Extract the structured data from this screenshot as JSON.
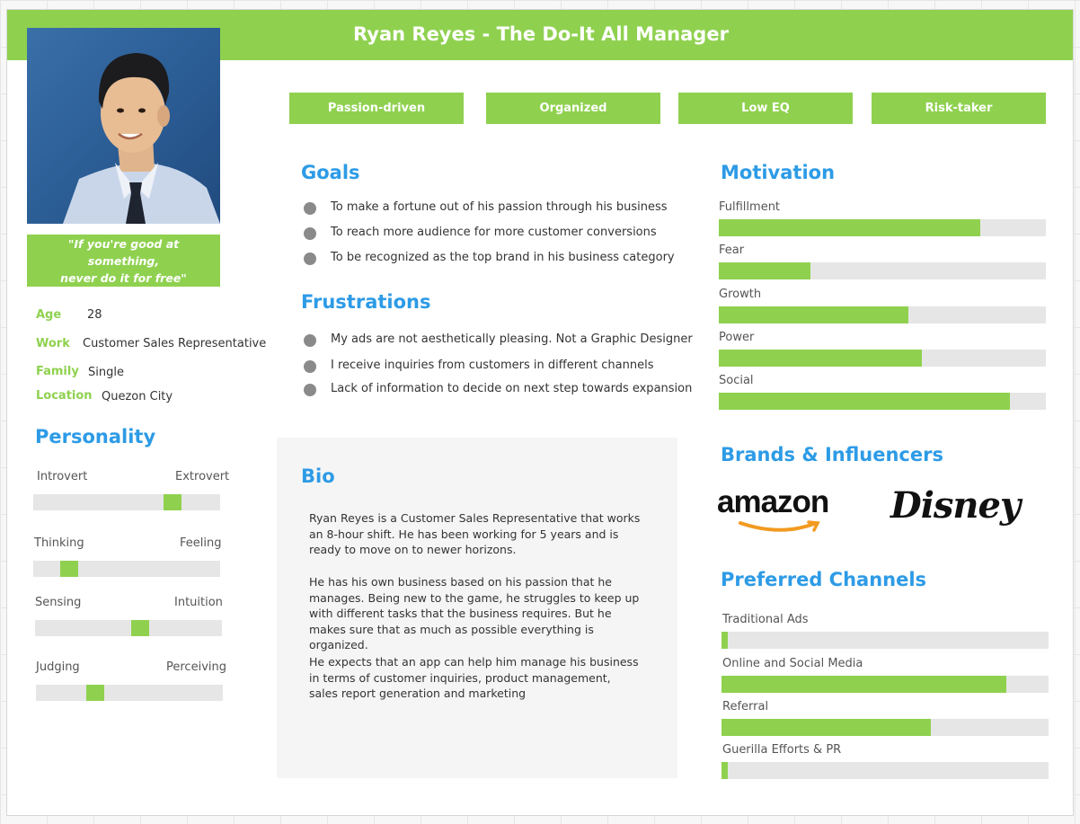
{
  "header": {
    "title": "Ryan Reyes - The Do-It All Manager"
  },
  "quote": {
    "line1": "\"If you're good at something,",
    "line2": "never do it for free\""
  },
  "info": [
    {
      "label": "Age",
      "value": "28"
    },
    {
      "label": "Work",
      "value": "Customer Sales Representative"
    },
    {
      "label": "Family",
      "value": "Single"
    },
    {
      "label": "Location",
      "value": "Quezon City"
    }
  ],
  "tags": [
    "Passion-driven",
    "Organized",
    "Low EQ",
    "Risk-taker"
  ],
  "personality": {
    "heading": "Personality",
    "traits": [
      {
        "left": "Introvert",
        "right": "Extrovert",
        "position": 0.77
      },
      {
        "left": "Thinking",
        "right": "Feeling",
        "position": 0.16
      },
      {
        "left": "Sensing",
        "right": "Intuition",
        "position": 0.57
      },
      {
        "left": "Judging",
        "right": "Perceiving",
        "position": 0.3
      }
    ]
  },
  "goals": {
    "heading": "Goals",
    "items": [
      "To make a fortune out of his passion through his business",
      "To reach more audience for more customer conversions",
      "To be recognized as the top brand in his business category"
    ]
  },
  "frustrations": {
    "heading": "Frustrations",
    "items": [
      "My ads are not aesthetically pleasing. Not a Graphic Designer",
      "I receive inquiries from customers in different channels",
      "Lack of information to decide on next step towards expansion"
    ]
  },
  "bio": {
    "heading": "Bio",
    "paragraphs": [
      "Ryan Reyes is a Customer Sales Representative that works an 8-hour shift. He has been working for 5 years and is ready to move on to newer horizons.",
      "He has his own business based on his passion that he manages. Being new to the game, he struggles to keep up with different tasks that the business requires. But he makes sure that as much as possible everything is organized.",
      "He expects that an app can help him manage his business in terms of customer inquiries, product management, sales report generation and marketing"
    ]
  },
  "motivation": {
    "heading": "Motivation",
    "items": [
      {
        "label": "Fulfillment",
        "level": 0.8
      },
      {
        "label": "Fear",
        "level": 0.28
      },
      {
        "label": "Growth",
        "level": 0.58
      },
      {
        "label": "Power",
        "level": 0.62
      },
      {
        "label": "Social",
        "level": 0.89
      }
    ]
  },
  "brands": {
    "heading": "Brands & Influencers",
    "items": [
      "amazon",
      "Disney"
    ]
  },
  "channels": {
    "heading": "Preferred Channels",
    "items": [
      {
        "label": "Traditional Ads",
        "level": 0.02
      },
      {
        "label": "Online and Social Media",
        "level": 0.87
      },
      {
        "label": "Referral",
        "level": 0.64
      },
      {
        "label": "Guerilla Efforts & PR",
        "level": 0.02
      }
    ]
  },
  "colors": {
    "accent": "#8fd14f",
    "heading": "#2d9be6",
    "track": "#e6e6e6"
  }
}
